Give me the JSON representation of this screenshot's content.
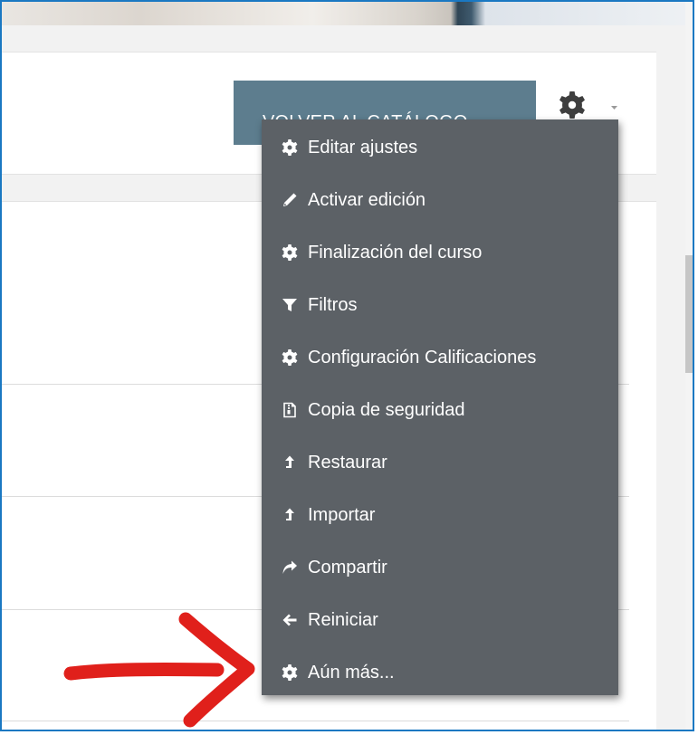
{
  "header": {
    "catalog_button_label": "VOLVER AL CATÁLOGO"
  },
  "settings_menu": {
    "items": [
      {
        "label": "Editar ajustes",
        "icon": "gear-icon"
      },
      {
        "label": "Activar edición",
        "icon": "pencil-icon"
      },
      {
        "label": "Finalización del curso",
        "icon": "gear-icon"
      },
      {
        "label": "Filtros",
        "icon": "filter-icon"
      },
      {
        "label": "Configuración Calificaciones",
        "icon": "gear-icon"
      },
      {
        "label": "Copia de seguridad",
        "icon": "file-archive-icon"
      },
      {
        "label": "Restaurar",
        "icon": "level-up-icon"
      },
      {
        "label": "Importar",
        "icon": "level-up-icon"
      },
      {
        "label": "Compartir",
        "icon": "share-icon"
      },
      {
        "label": "Reiniciar",
        "icon": "arrow-left-icon"
      },
      {
        "label": "Aún más...",
        "icon": "gear-icon"
      }
    ]
  },
  "colors": {
    "button_bg": "#5d7d8e",
    "menu_bg": "#5c6166",
    "annotation_arrow": "#e0201b",
    "frame_border": "#1a78c2"
  }
}
